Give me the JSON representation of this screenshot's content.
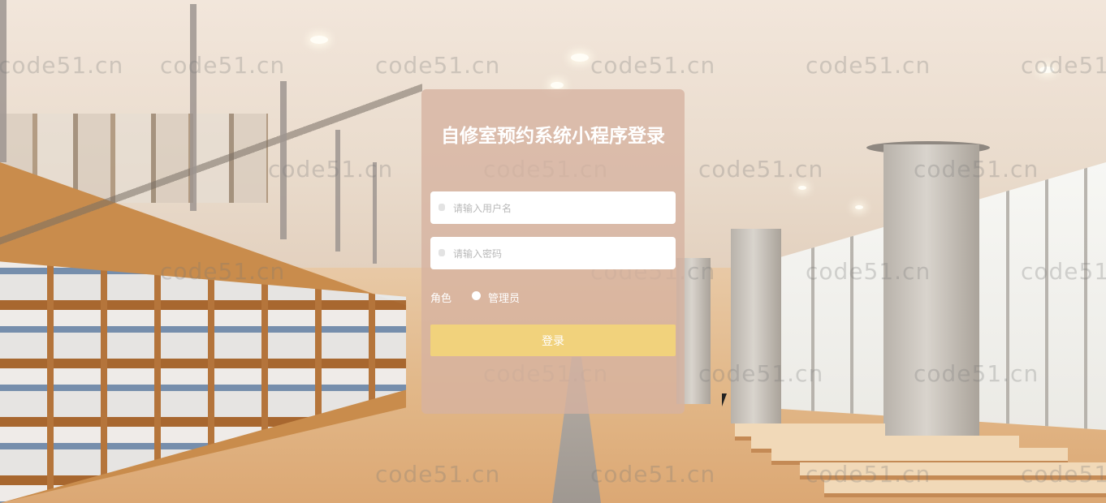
{
  "page": {
    "title": "自修室预约系统小程序登录"
  },
  "form": {
    "username_placeholder": "请输入用户名",
    "password_placeholder": "请输入密码",
    "role_label": "角色",
    "role_option": "管理员",
    "role_selected": "管理员",
    "login_button": "登录"
  },
  "watermark": {
    "text": "code51.cn"
  },
  "colors": {
    "panel": "#d6b2a0",
    "login_button": "#f1d27c",
    "title_text": "#ffffff"
  },
  "icons": [
    "user-icon",
    "lock-icon"
  ]
}
